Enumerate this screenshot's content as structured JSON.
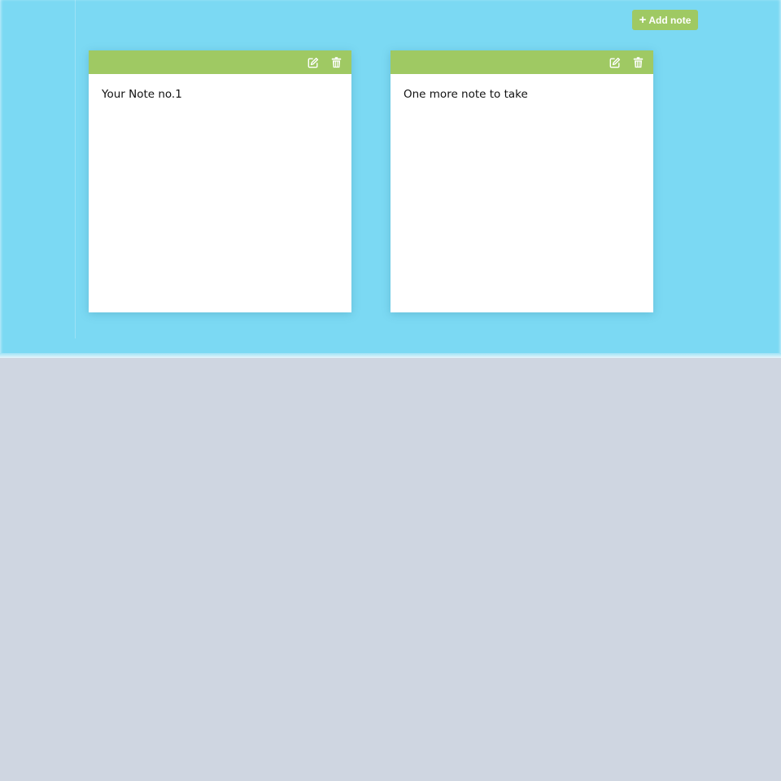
{
  "toolbar": {
    "add_note_label": "Add note",
    "add_note_icon": "plus-icon"
  },
  "notes": [
    {
      "text": "Your Note no.1",
      "edit_icon": "edit-icon",
      "delete_icon": "trash-icon"
    },
    {
      "text": "One more note to take",
      "edit_icon": "edit-icon",
      "delete_icon": "trash-icon"
    }
  ],
  "colors": {
    "app_background": "#7bd9f3",
    "page_background": "#cfd6e1",
    "accent": "#9fc963",
    "note_background": "#ffffff",
    "note_text": "#111111"
  }
}
